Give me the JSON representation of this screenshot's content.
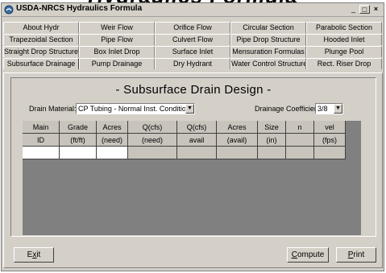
{
  "page_title_clipped": "Hydraulics Formula",
  "window": {
    "title": "USDA-NRCS Hydraulics Formula",
    "controls": {
      "minimize": "_",
      "maximize": "□",
      "close": "×"
    }
  },
  "tabs": {
    "row1": [
      "About Hydr",
      "Weir Flow",
      "Orifice Flow",
      "Circular Section",
      "Parabolic Section"
    ],
    "row2": [
      "Trapezoidal Section",
      "Pipe Flow",
      "Culvert Flow",
      "Pipe Drop Structure",
      "Hooded Inlet"
    ],
    "row3": [
      "Straight Drop Structure",
      "Box Inlet Drop",
      "Surface Inlet",
      "Mensuration Formulas",
      "Plunge Pool"
    ],
    "row4": [
      "Subsurface Drainage",
      "Pump Drainage",
      "Dry Hydrant",
      "Water Control Structure",
      "Rect. Riser Drop"
    ],
    "active": "Subsurface Drainage"
  },
  "form": {
    "heading": "- Subsurface Drain Design -",
    "drain_material_label": "Drain Material:",
    "drain_material_value": "CP Tubing - Normal Inst. Condition",
    "drainage_coefficient_label": "Drainage Coefficient:",
    "drainage_coefficient_value": "3/8"
  },
  "table": {
    "header_row1": [
      "Main",
      "Grade",
      "Acres",
      "Q(cfs)",
      "Q(cfs)",
      "Acres",
      "Size",
      "n",
      "vel"
    ],
    "header_row2": [
      "ID",
      "(ft/ft)",
      "(need)",
      "(need)",
      "avail",
      "(avail)",
      "(in)",
      "",
      "(fps)"
    ],
    "data_rows": [
      [
        "",
        "",
        "",
        "",
        "",
        "",
        "",
        "",
        ""
      ]
    ]
  },
  "buttons": {
    "exit_u": "x",
    "exit_pre": "E",
    "exit_post": "it",
    "compute_u": "C",
    "compute_post": "ompute",
    "print_u": "P",
    "print_post": "rint"
  },
  "colors": {
    "face": "#d4d0c8",
    "grid_bg": "#808080",
    "entry": "#ffffff"
  }
}
